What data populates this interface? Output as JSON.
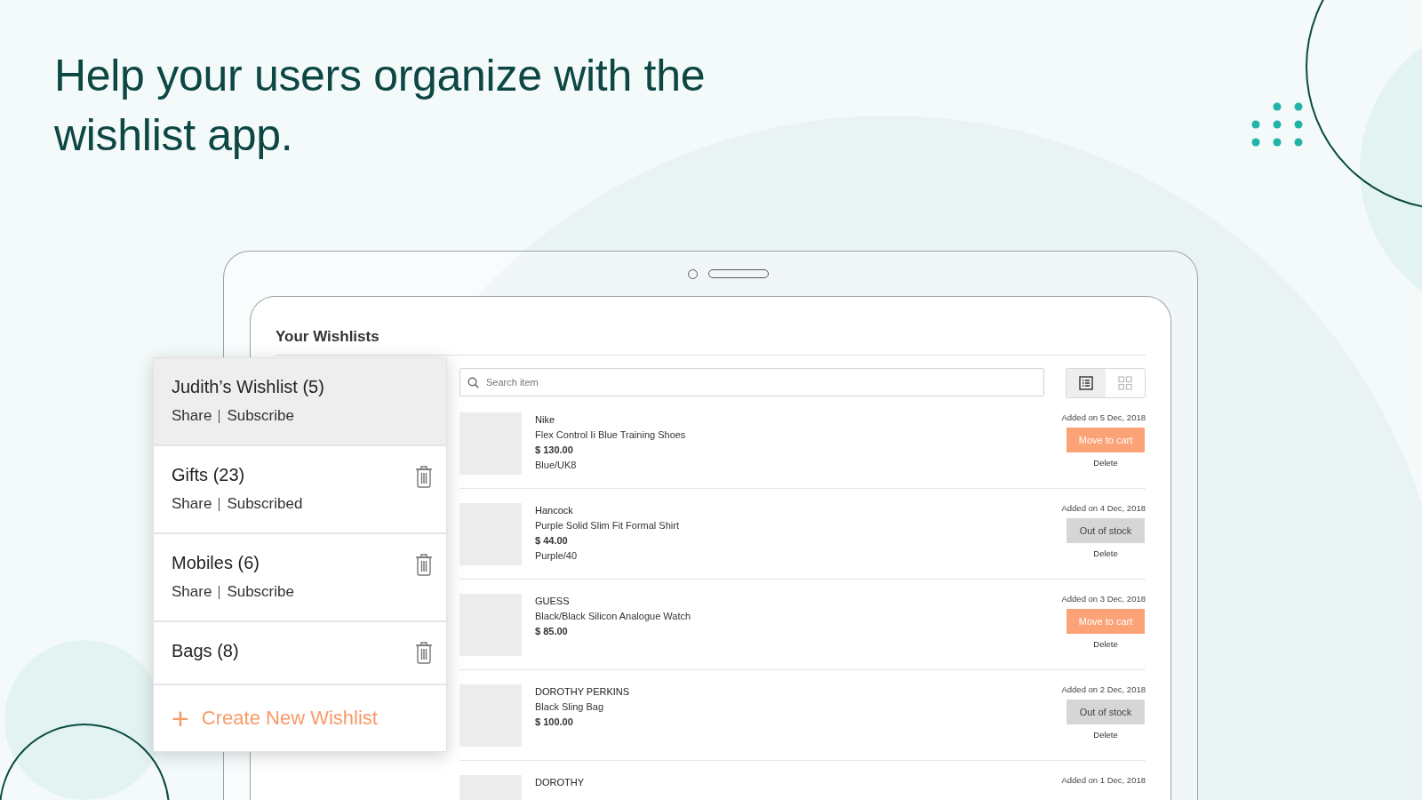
{
  "headline": "Help your users organize with the wishlist app.",
  "app": {
    "title": "Your Wishlists",
    "search": {
      "placeholder": "Search item"
    },
    "view_toggle": [
      {
        "kind": "list",
        "selected": true
      },
      {
        "kind": "grid",
        "selected": false
      }
    ],
    "wishlists": [
      {
        "name": "Judith’s Wishlist (5)",
        "share": "Share",
        "subscribe": "Subscribe",
        "selected": true,
        "deletable": false
      },
      {
        "name": "Gifts (23)",
        "share": "Share",
        "subscribe": "Subscribed",
        "selected": false,
        "deletable": true
      },
      {
        "name": "Mobiles (6)",
        "share": "Share",
        "subscribe": "Subscribe",
        "selected": false,
        "deletable": true
      },
      {
        "name": "Bags (8)",
        "selected": false,
        "deletable": true
      }
    ],
    "create_button": {
      "icon": "+",
      "label": "Create New Wishlist"
    },
    "items": [
      {
        "brand": "Nike",
        "name": "Flex Control Ii Blue Training Shoes",
        "price": "$ 130.00",
        "variant": "Blue/UK8",
        "added": "Added on 5 Dec, 2018",
        "kind": "move_to_cart",
        "action": "Move to cart",
        "delete": "Delete"
      },
      {
        "brand": "Hancock",
        "name": "Purple Solid Slim Fit Formal Shirt",
        "price": "$ 44.00",
        "variant": "Purple/40",
        "added": "Added on 4 Dec, 2018",
        "kind": "out_of_stock",
        "action": "Out of stock",
        "delete": "Delete"
      },
      {
        "brand": "GUESS",
        "name": "Black/Black Silicon Analogue Watch",
        "price": "$ 85.00",
        "added": "Added on 3 Dec, 2018",
        "kind": "move_to_cart",
        "action": "Move to cart",
        "delete": "Delete"
      },
      {
        "brand": "DOROTHY PERKINS",
        "name": "Black Sling Bag",
        "price": "$ 100.00",
        "added": "Added on 2 Dec, 2018",
        "kind": "out_of_stock",
        "action": "Out of stock",
        "delete": "Delete"
      },
      {
        "brand": "DOROTHY",
        "added": "Added on 1 Dec, 2018"
      }
    ]
  }
}
